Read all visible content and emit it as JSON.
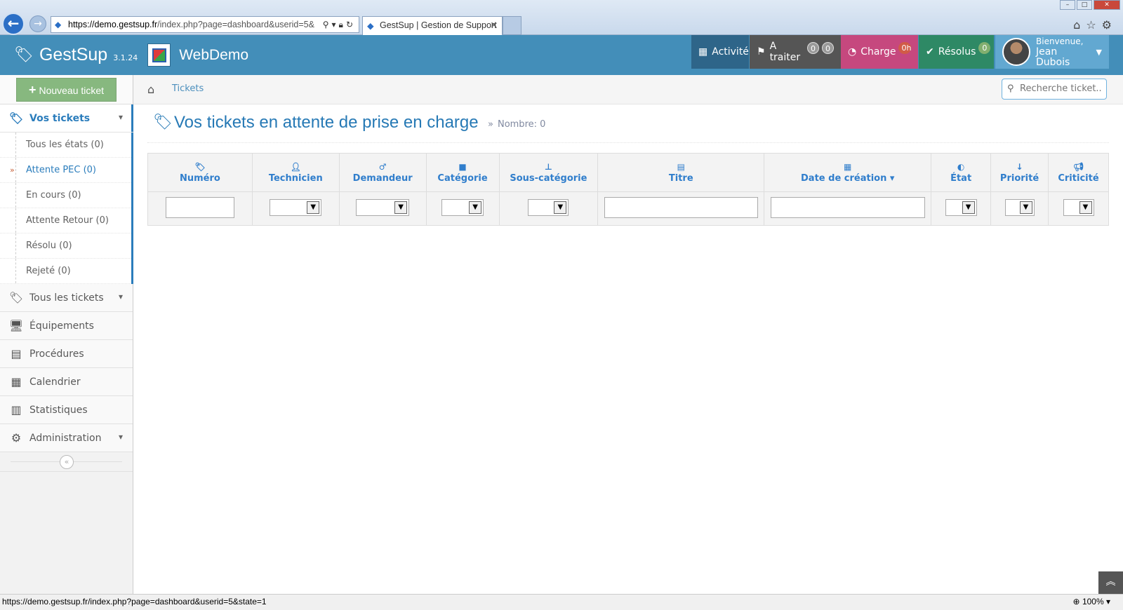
{
  "browser": {
    "url_prefix": "https://demo.",
    "url_domain": "gestsup.fr",
    "url_rest": "/index.php?page=dashboard&userid=5&",
    "tab_title": "GestSup | Gestion de Support",
    "tab_close": "✕"
  },
  "app": {
    "name": "GestSup",
    "version": "3.1.24",
    "site": "WebDemo"
  },
  "topnav": {
    "activite": "Activité",
    "traiter": "A traiter",
    "traiter_badge1": "0",
    "traiter_badge2": "0",
    "charge": "Charge",
    "charge_badge": "0h",
    "resolus": "Résolus",
    "resolus_badge": "0",
    "welcome": "Bienvenue,",
    "user": "Jean Dubois"
  },
  "sidebar": {
    "new_ticket": "Nouveau ticket",
    "vos_tickets": "Vos tickets",
    "sub": [
      "Tous les états (0)",
      "Attente PEC (0)",
      "En cours (0)",
      "Attente Retour (0)",
      "Résolu (0)",
      "Rejeté (0)"
    ],
    "tous_tickets": "Tous les tickets",
    "equipements": "Équipements",
    "procedures": "Procédures",
    "calendrier": "Calendrier",
    "statistiques": "Statistiques",
    "administration": "Administration"
  },
  "breadcrumb": {
    "tickets": "Tickets",
    "search_placeholder": "Recherche ticket..."
  },
  "main": {
    "title": "Vos tickets en attente de prise en charge",
    "count": "Nombre: 0",
    "columns": [
      "Numéro",
      "Technicien",
      "Demandeur",
      "Catégorie",
      "Sous-catégorie",
      "Titre",
      "Date de création",
      "État",
      "Priorité",
      "Criticité"
    ]
  },
  "status": {
    "url": "https://demo.gestsup.fr/index.php?page=dashboard&userid=5&state=1",
    "zoom": "100%"
  }
}
